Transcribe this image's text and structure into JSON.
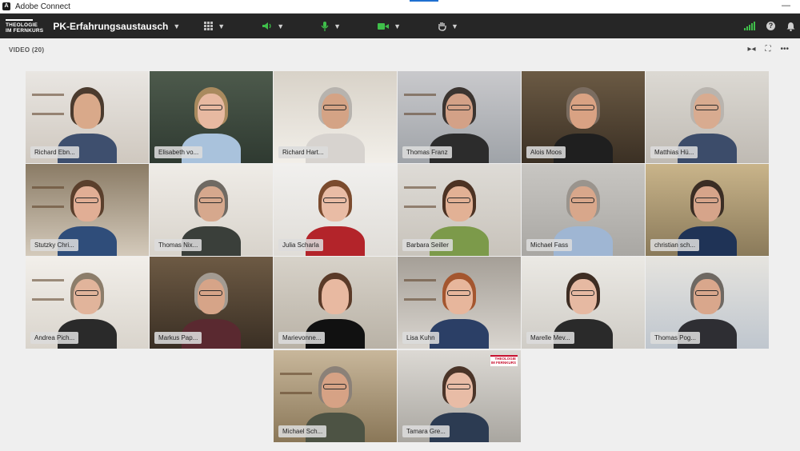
{
  "window": {
    "title": "Adobe Connect",
    "minimize": "—"
  },
  "toolbar": {
    "brand_line1": "THEOLOGIE",
    "brand_line2": "IM FERNKURS",
    "meeting_name": "PK-Erfahrungsaustausch",
    "icons": [
      "apps-grid-icon",
      "speaker-icon",
      "microphone-icon",
      "camera-icon",
      "raise-hand-icon",
      "signal-icon",
      "help-icon",
      "notification-bell-icon"
    ],
    "colors": {
      "toolbar_bg": "#262626",
      "status_green": "#3fbf4a"
    }
  },
  "video_pod": {
    "header": "VIDEO (20)",
    "participants": [
      "Richard Ebn...",
      "Elisabeth vo...",
      "Richard Hart...",
      "Thomas Franz",
      "Alois Moos",
      "Matthias Hü...",
      "Stutzky Chri...",
      "Thomas Nix...",
      "Julia Scharla",
      "Barbara Seiller",
      "Michael Fass",
      "christian sch...",
      "Andrea Pich...",
      "Markus Pap...",
      "Marievonne...",
      "Lisa Kuhn",
      "Marelle Mev...",
      "Thomas Pog...",
      "Michael Sch...",
      "Tamara Gre..."
    ],
    "badge_line1": "THEOLOGIE",
    "badge_line2": "IM FERNKURS"
  }
}
